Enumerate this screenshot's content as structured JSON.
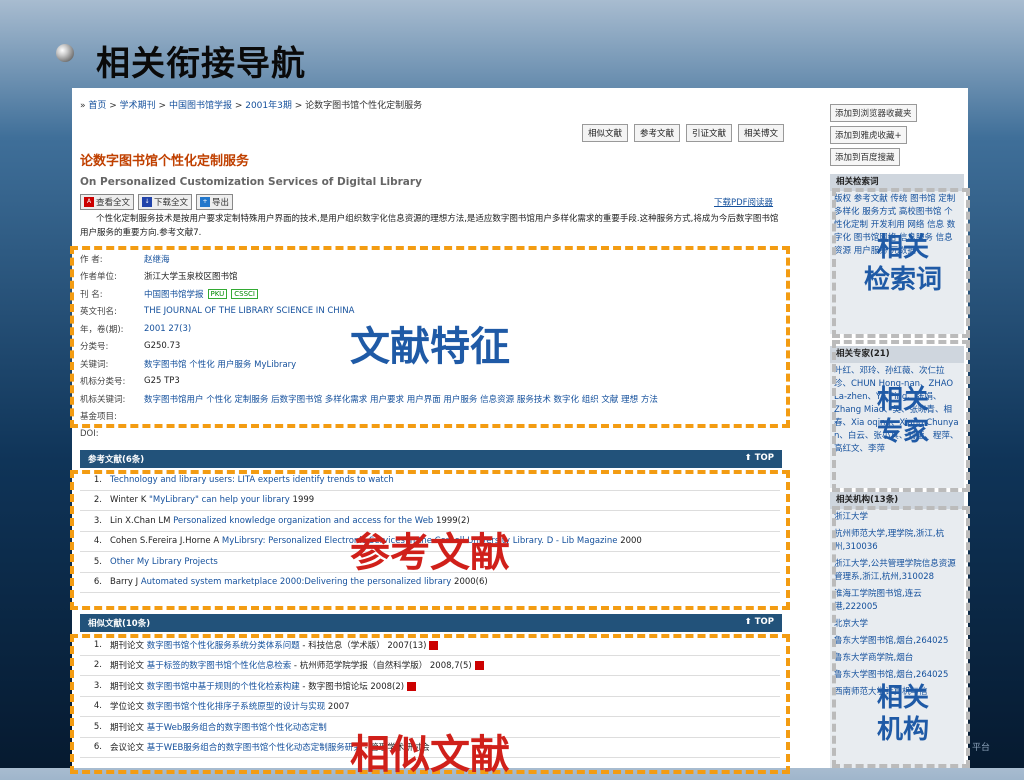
{
  "slide": {
    "title": "相关衔接导航"
  },
  "breadcrumb": [
    "首页",
    "学术期刊",
    "中国图书馆学报",
    "2001年3期",
    "论数字图书馆个性化定制服务"
  ],
  "related_links": [
    "相似文献",
    "参考文献",
    "引证文献",
    "相关博文"
  ],
  "article": {
    "title": "论数字图书馆个性化定制服务",
    "title_en": "On Personalized Customization Services of Digital Library",
    "actions": [
      "查看全文",
      "下载全文",
      "导出"
    ],
    "pdf_reader": "下载PDF阅读器",
    "abstract": "个性化定制服务技术是按用户要求定制特殊用户界面的技术,是用户组织数字化信息资源的理想方法,是适应数字图书馆用户多样化需求的重要手段.这种服务方式,将成为今后数字图书馆用户服务的重要方向.参考文献7."
  },
  "meta": [
    {
      "k": "作 者:",
      "v": "赵继海",
      "link": true
    },
    {
      "k": "作者单位:",
      "v": "浙江大学玉泉校区图书馆",
      "link": false
    },
    {
      "k": "刊 名:",
      "v": "中国图书馆学报",
      "link": true,
      "tags": [
        "PKU",
        "CSSCI"
      ]
    },
    {
      "k": "英文刊名:",
      "v": "THE JOURNAL OF THE LIBRARY SCIENCE IN CHINA",
      "link": true
    },
    {
      "k": "年，卷(期):",
      "v": "2001 27(3)",
      "link": true
    },
    {
      "k": "分类号:",
      "v": "G250.73",
      "link": false
    },
    {
      "k": "关键词:",
      "v": "数字图书馆   个性化   用户服务   MyLibrary",
      "link": true
    },
    {
      "k": "机标分类号:",
      "v": "G25 TP3",
      "link": false
    },
    {
      "k": "机标关键词:",
      "v": "数字图书馆用户 个性化 定制服务 后数字图书馆 多样化需求 用户要求 用户界面 用户服务 信息资源 服务技术 数字化 组织 文献 理想 方法",
      "link": true
    },
    {
      "k": "基金项目:",
      "v": "",
      "link": false
    },
    {
      "k": "DOI:",
      "v": "",
      "link": false
    }
  ],
  "refs": {
    "heading": "参考文献(6条)",
    "top": "TOP",
    "items": [
      {
        "n": "1.",
        "pre": "",
        "lk": "Technology and library users: LITA experts identify trends to watch",
        "post": ""
      },
      {
        "n": "2.",
        "pre": "Winter K ",
        "lk": "\"MyLibrary\" can help your library",
        "post": " 1999"
      },
      {
        "n": "3.",
        "pre": "Lin X.Chan LM ",
        "lk": "Personalized knowledge organization and access for the Web",
        "post": " 1999(2)"
      },
      {
        "n": "4.",
        "pre": "Cohen S.Fereira J.Horne A ",
        "lk": "MyLibrsry: Personalized Electronic Services in the Cornell University Library. D - Lib Magazine",
        "post": " 2000"
      },
      {
        "n": "5.",
        "pre": "",
        "lk": "Other My Library Projects",
        "post": ""
      },
      {
        "n": "6.",
        "pre": "Barry J ",
        "lk": "Automated system marketplace 2000:Delivering the personalized library",
        "post": " 2000(6)"
      }
    ]
  },
  "similar": {
    "heading": "相似文献(10条)",
    "top": "TOP",
    "items": [
      {
        "n": "1.",
        "pre": "期刊论文 ",
        "lk": "数字图书馆个性化服务系统分类体系问题",
        "post": " - 科技信息（学术版） 2007(13)"
      },
      {
        "n": "2.",
        "pre": "期刊论文 ",
        "lk": "基于标签的数字图书馆个性化信息检索",
        "post": " - 杭州师范学院学报（自然科学版） 2008,7(5)"
      },
      {
        "n": "3.",
        "pre": "期刊论文 ",
        "lk": "数字图书馆中基于规则的个性化检索构建",
        "post": " - 数字图书馆论坛 2008(2)"
      },
      {
        "n": "4.",
        "pre": "学位论文 ",
        "lk": "数字图书馆个性化排序子系统原型的设计与实现",
        "post": " 2007"
      },
      {
        "n": "5.",
        "pre": "期刊论文 ",
        "lk": "基于Web服务组合的数字图书馆个性化动态定制",
        "post": ""
      },
      {
        "n": "6.",
        "pre": "会议论文 ",
        "lk": "基于WEB服务组合的数字图书馆个性化动态定制服务研究",
        "post": " - 管理学术研讨会"
      }
    ]
  },
  "side": {
    "favorites": [
      "添加到浏览器收藏夹",
      "添加到雅虎收藏+",
      "添加到百度搜藏"
    ],
    "search_words": {
      "heading": "相关检索词",
      "body": "版权  参考文献  传统  图书馆  定制  多样化  服务方式  高校图书馆  个性化定制  开发利用  网络  信息  数字化  图书馆网络  信息服务  信息资源  用户服务  元数据"
    },
    "experts": {
      "heading": "相关专家(21)",
      "body": "叶红、邓玲、孙红薇、次仁拉珍、CHUN Hong-nan、ZHAO La-zhen、YE Ping、张娟、Zhang Miao、吴、张晓青、相春、Xia oqing、Xiang Chunya n、白云、张小真、刘莹、程萍、高红文、李萍"
    },
    "orgs": {
      "heading": "相关机构(13条)",
      "items": [
        "浙江大学",
        "杭州师范大学,理学院,浙江,杭州,310036",
        "浙江大学,公共管理学院信息资源管理系,浙江,杭州,310028",
        "淮海工学院图书馆,连云港,222005",
        "北京大学",
        "鲁东大学图书馆,烟台,264025",
        "鲁东大学商学院,烟台",
        "鲁东大学图书馆,烟台,264025",
        "西南师范大学计算机与信"
      ]
    }
  },
  "annotations": {
    "features": "文献特征",
    "refs": "参考文献",
    "similar": "相似文献",
    "search_words": "相关\n检索词",
    "experts": "相关\n专家",
    "orgs": "相关\n机构"
  },
  "footer": "平台"
}
